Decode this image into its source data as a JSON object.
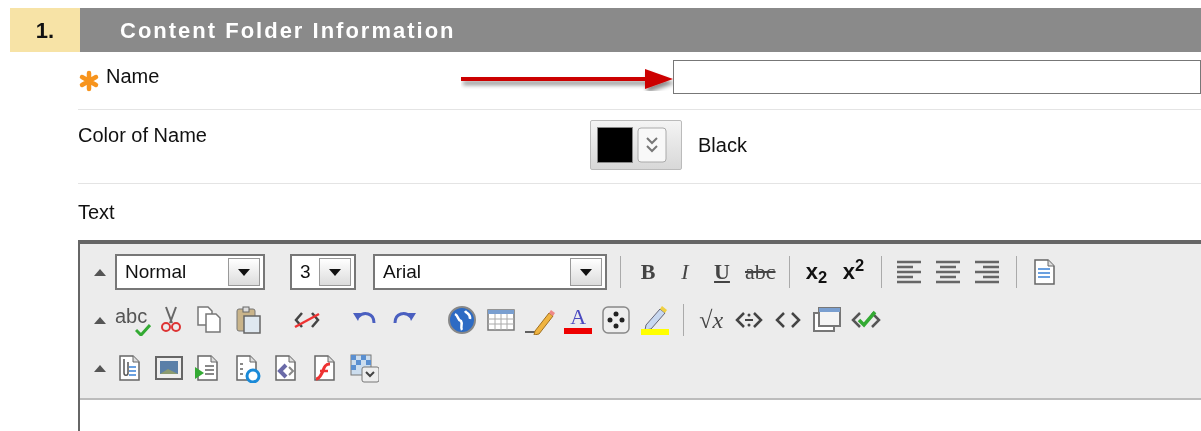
{
  "section": {
    "number": "1.",
    "title": "Content Folder Information"
  },
  "fields": [
    {
      "kind": "text",
      "label": "Name",
      "required": true
    },
    {
      "kind": "color",
      "label": "Color of Name",
      "color": "#000000",
      "value": "Black"
    },
    {
      "kind": "editor",
      "label": "Text"
    }
  ],
  "toolbar_rows": [
    {
      "items": [
        {
          "kind": "select",
          "value": "Normal"
        },
        {
          "kind": "select",
          "value": "3"
        },
        {
          "kind": "select",
          "value": "Arial"
        },
        {
          "kind": "sep"
        },
        {
          "kind": "bold",
          "label": "B"
        },
        {
          "kind": "italic",
          "label": "I"
        },
        {
          "kind": "underline",
          "label": "U"
        },
        {
          "kind": "strike",
          "label": "abc"
        },
        {
          "kind": "sep"
        },
        {
          "kind": "subscript",
          "label": "x$_{2}$"
        },
        {
          "kind": "superscript",
          "label": "x$^{2}$"
        },
        {
          "kind": "sep"
        },
        {
          "kind": "align-left"
        },
        {
          "kind": "align-center"
        },
        {
          "kind": "align-right"
        },
        {
          "kind": "sep"
        },
        {
          "kind": "document"
        }
      ]
    },
    {
      "items": [
        {
          "kind": "spell",
          "label": "abc"
        },
        {
          "kind": "cut"
        },
        {
          "kind": "copy"
        },
        {
          "kind": "paste"
        },
        {
          "kind": "gap"
        },
        {
          "kind": "unformat"
        },
        {
          "kind": "gap"
        },
        {
          "kind": "undo"
        },
        {
          "kind": "redo"
        },
        {
          "kind": "gap"
        },
        {
          "kind": "globe"
        },
        {
          "kind": "table"
        },
        {
          "kind": "pencil"
        },
        {
          "kind": "fontcolor",
          "label": "A"
        },
        {
          "kind": "dice"
        },
        {
          "kind": "highlight"
        },
        {
          "kind": "sep"
        },
        {
          "kind": "math",
          "label": "√x"
        },
        {
          "kind": "code-split"
        },
        {
          "kind": "code"
        },
        {
          "kind": "window"
        },
        {
          "kind": "code-check"
        }
      ]
    },
    {
      "items": [
        {
          "kind": "attach"
        },
        {
          "kind": "image"
        },
        {
          "kind": "media"
        },
        {
          "kind": "quicktime"
        },
        {
          "kind": "doc-code"
        },
        {
          "kind": "flash"
        },
        {
          "kind": "mashup"
        }
      ]
    }
  ]
}
